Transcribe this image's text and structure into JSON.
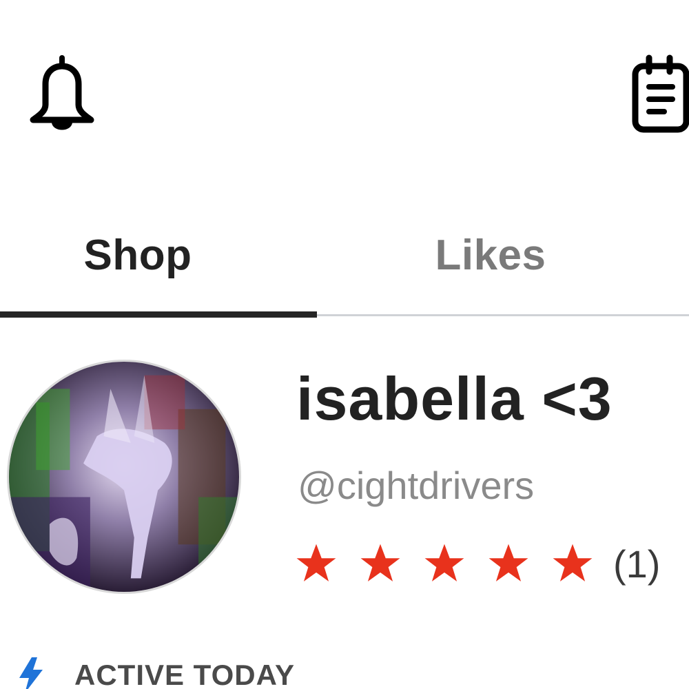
{
  "header": {
    "left_icon": "bell-icon",
    "right_icon": "notes-icon"
  },
  "tabs": [
    {
      "label": "Shop",
      "active": true
    },
    {
      "label": "Likes",
      "active": false
    }
  ],
  "profile": {
    "display_name": "isabella <3",
    "username": "@cightdrivers",
    "rating": 5,
    "rating_max": 5,
    "review_count": "(1)",
    "avatar_icon": "avatar"
  },
  "status": {
    "icon": "lightning-bolt-icon",
    "text": "ACTIVE TODAY"
  },
  "colors": {
    "star": "#e8321c",
    "bolt": "#1f73d8",
    "active_tab": "#222222",
    "inactive_tab": "#7a7a7a"
  }
}
